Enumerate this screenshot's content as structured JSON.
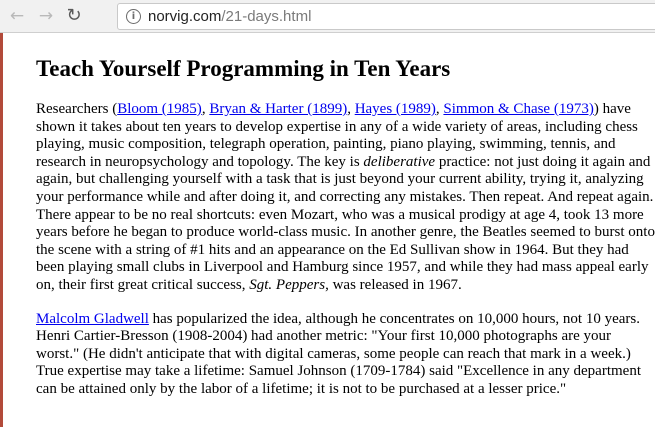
{
  "browser": {
    "url_host": "norvig.com",
    "url_path": "/21-days.html"
  },
  "page": {
    "title": "Teach Yourself Programming in Ten Years",
    "p1": {
      "t0": "Researchers (",
      "link_bloom": "Bloom (1985)",
      "sep1": ", ",
      "link_bryan": "Bryan & Harter (1899)",
      "sep2": ", ",
      "link_hayes": "Hayes (1989)",
      "sep3": ", ",
      "link_simmon": "Simmon & Chase (1973)",
      "t1": ") have shown it takes about ten years to develop expertise in any of a wide variety of areas, including chess playing, music composition, telegraph operation, painting, piano playing, swimming, tennis, and research in neuropsychology and topology. The key is ",
      "em_deliberative": "deliberative",
      "t2": " practice: not just doing it again and again, but challenging yourself with a task that is just beyond your current ability, trying it, analyzing your performance while and after doing it, and correcting any mistakes. Then repeat. And repeat again. There appear to be no real shortcuts: even Mozart, who was a musical prodigy at age 4, took 13 more years before he began to produce world-class music. In another genre, the Beatles seemed to burst onto the scene with a string of #1 hits and an appearance on the Ed Sullivan show in 1964. But they had been playing small clubs in Liverpool and Hamburg since 1957, and while they had mass appeal early on, their first great critical success, ",
      "em_sgt": "Sgt. Peppers",
      "t3": ", was released in 1967."
    },
    "p2": {
      "link_gladwell": "Malcolm Gladwell",
      "t1": " has popularized the idea, although he concentrates on 10,000 hours, not 10 years. Henri Cartier-Bresson (1908-2004) had another metric: \"Your first 10,000 photographs are your worst.\" (He didn't anticipate that with digital cameras, some people can reach that mark in a week.) True expertise may take a lifetime: Samuel Johnson (1709-1784) said \"Excellence in any department can be attained only by the labor of a lifetime; it is not to be purchased at a lesser price.\""
    }
  }
}
